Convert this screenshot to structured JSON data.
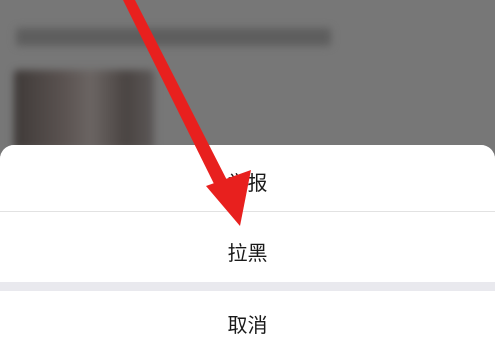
{
  "action_sheet": {
    "options": [
      {
        "label": "举报"
      },
      {
        "label": "拉黑"
      }
    ],
    "cancel_label": "取消"
  },
  "colors": {
    "overlay": "#777777",
    "sheet_background": "#e9e9ee",
    "option_background": "#ffffff",
    "text": "#1a1a1a",
    "annotation_arrow": "#e8201e"
  },
  "annotation": {
    "icon": "red-arrow-icon",
    "points_to": "拉黑"
  }
}
